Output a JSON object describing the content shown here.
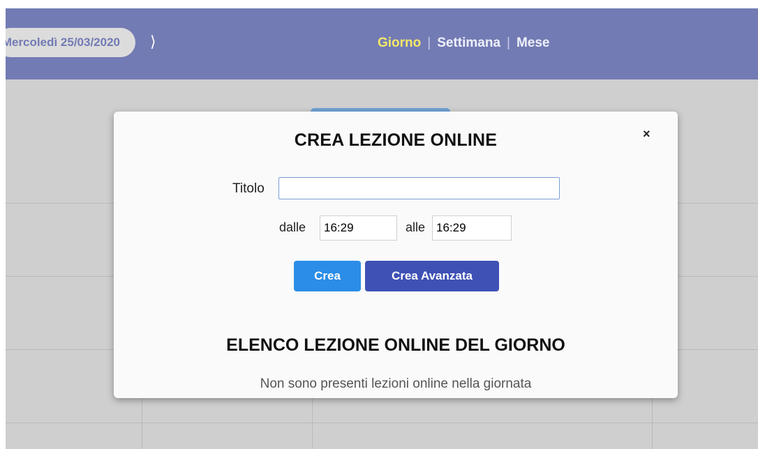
{
  "header": {
    "date_label": "Mercoledì 25/03/2020",
    "next_arrow": "⟩",
    "views": [
      {
        "label": "Giorno",
        "active": true
      },
      {
        "label": "Settimana",
        "active": false
      },
      {
        "label": "Mese",
        "active": false
      }
    ],
    "separator": "|"
  },
  "colors": {
    "header_bg": "#737bb4",
    "active_view": "#f3e869",
    "crea_button": "#2b8de8",
    "crea_avanzata_button": "#3f51b5"
  },
  "modal": {
    "title": "CREA LEZIONE ONLINE",
    "close_icon": "×",
    "title_label": "Titolo",
    "title_value": "",
    "from_label": "dalle",
    "from_value": "16:29",
    "to_label": "alle",
    "to_value": "16:29",
    "crea_label": "Crea",
    "crea_avanzata_label": "Crea Avanzata",
    "list_title": "ELENCO LEZIONE ONLINE DEL GIORNO",
    "empty_message": "Non sono presenti lezioni online nella giornata"
  }
}
